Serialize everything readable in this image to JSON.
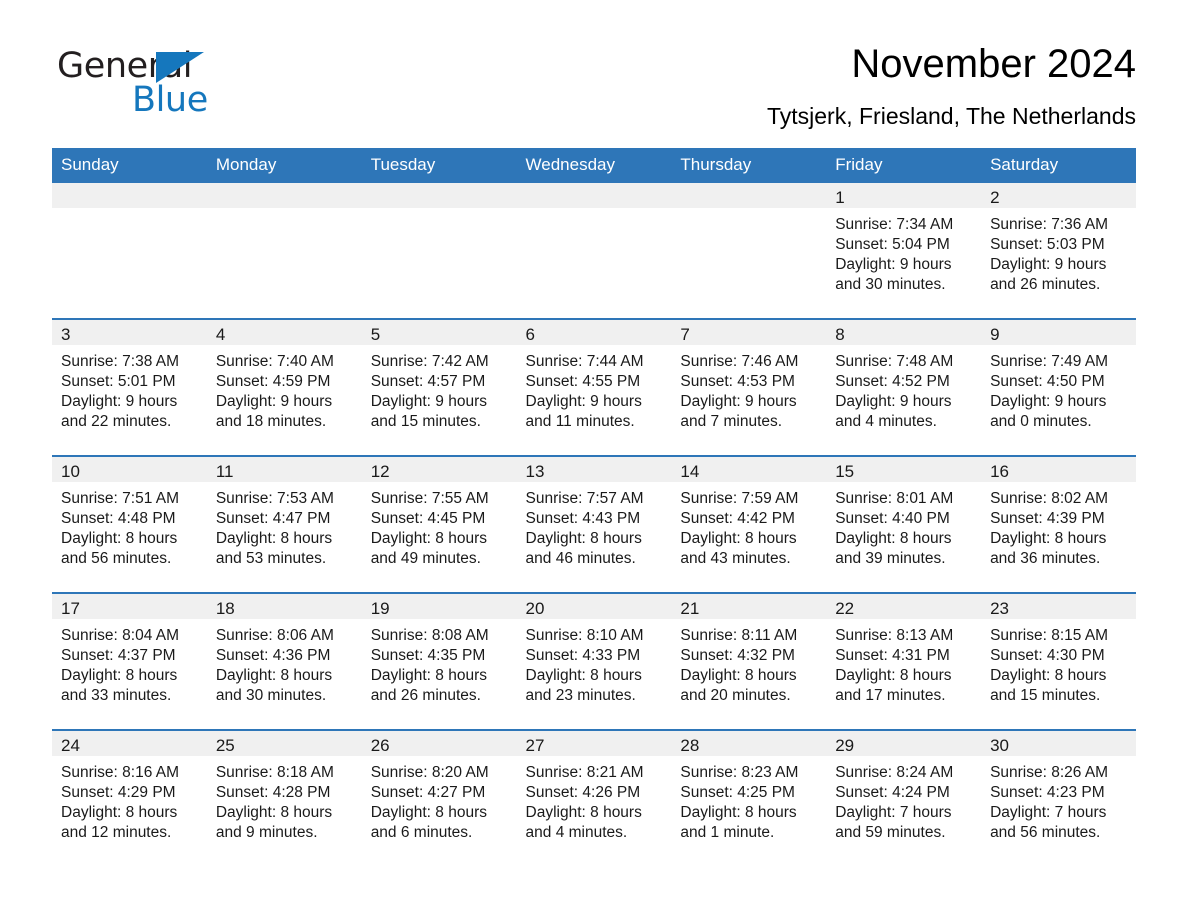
{
  "brand": {
    "name_dark": "General",
    "name_blue": "Blue",
    "triangle_icon": "blue-triangle-logo-mark",
    "accent_color": "#1577bd"
  },
  "header": {
    "month_title": "November 2024",
    "location": "Tytsjerk, Friesland, The Netherlands"
  },
  "theme": {
    "header_band": "#2e76b8",
    "date_band": "#f0f0f0",
    "rule": "#2e76b8",
    "text": "#1a1a1a",
    "page_background": "#ffffff"
  },
  "weekday_headers": [
    "Sunday",
    "Monday",
    "Tuesday",
    "Wednesday",
    "Thursday",
    "Friday",
    "Saturday"
  ],
  "labels": {
    "sunrise_prefix": "Sunrise:",
    "sunset_prefix": "Sunset:",
    "daylight_prefix": "Daylight:"
  },
  "weeks": [
    [
      {
        "date": "",
        "empty": true
      },
      {
        "date": "",
        "empty": true
      },
      {
        "date": "",
        "empty": true
      },
      {
        "date": "",
        "empty": true
      },
      {
        "date": "",
        "empty": true
      },
      {
        "date": "1",
        "sunrise": "Sunrise: 7:34 AM",
        "sunset": "Sunset: 5:04 PM",
        "daylight_line1": "Daylight: 9 hours",
        "daylight_line2": "and 30 minutes."
      },
      {
        "date": "2",
        "sunrise": "Sunrise: 7:36 AM",
        "sunset": "Sunset: 5:03 PM",
        "daylight_line1": "Daylight: 9 hours",
        "daylight_line2": "and 26 minutes."
      }
    ],
    [
      {
        "date": "3",
        "sunrise": "Sunrise: 7:38 AM",
        "sunset": "Sunset: 5:01 PM",
        "daylight_line1": "Daylight: 9 hours",
        "daylight_line2": "and 22 minutes."
      },
      {
        "date": "4",
        "sunrise": "Sunrise: 7:40 AM",
        "sunset": "Sunset: 4:59 PM",
        "daylight_line1": "Daylight: 9 hours",
        "daylight_line2": "and 18 minutes."
      },
      {
        "date": "5",
        "sunrise": "Sunrise: 7:42 AM",
        "sunset": "Sunset: 4:57 PM",
        "daylight_line1": "Daylight: 9 hours",
        "daylight_line2": "and 15 minutes."
      },
      {
        "date": "6",
        "sunrise": "Sunrise: 7:44 AM",
        "sunset": "Sunset: 4:55 PM",
        "daylight_line1": "Daylight: 9 hours",
        "daylight_line2": "and 11 minutes."
      },
      {
        "date": "7",
        "sunrise": "Sunrise: 7:46 AM",
        "sunset": "Sunset: 4:53 PM",
        "daylight_line1": "Daylight: 9 hours",
        "daylight_line2": "and 7 minutes."
      },
      {
        "date": "8",
        "sunrise": "Sunrise: 7:48 AM",
        "sunset": "Sunset: 4:52 PM",
        "daylight_line1": "Daylight: 9 hours",
        "daylight_line2": "and 4 minutes."
      },
      {
        "date": "9",
        "sunrise": "Sunrise: 7:49 AM",
        "sunset": "Sunset: 4:50 PM",
        "daylight_line1": "Daylight: 9 hours",
        "daylight_line2": "and 0 minutes."
      }
    ],
    [
      {
        "date": "10",
        "sunrise": "Sunrise: 7:51 AM",
        "sunset": "Sunset: 4:48 PM",
        "daylight_line1": "Daylight: 8 hours",
        "daylight_line2": "and 56 minutes."
      },
      {
        "date": "11",
        "sunrise": "Sunrise: 7:53 AM",
        "sunset": "Sunset: 4:47 PM",
        "daylight_line1": "Daylight: 8 hours",
        "daylight_line2": "and 53 minutes."
      },
      {
        "date": "12",
        "sunrise": "Sunrise: 7:55 AM",
        "sunset": "Sunset: 4:45 PM",
        "daylight_line1": "Daylight: 8 hours",
        "daylight_line2": "and 49 minutes."
      },
      {
        "date": "13",
        "sunrise": "Sunrise: 7:57 AM",
        "sunset": "Sunset: 4:43 PM",
        "daylight_line1": "Daylight: 8 hours",
        "daylight_line2": "and 46 minutes."
      },
      {
        "date": "14",
        "sunrise": "Sunrise: 7:59 AM",
        "sunset": "Sunset: 4:42 PM",
        "daylight_line1": "Daylight: 8 hours",
        "daylight_line2": "and 43 minutes."
      },
      {
        "date": "15",
        "sunrise": "Sunrise: 8:01 AM",
        "sunset": "Sunset: 4:40 PM",
        "daylight_line1": "Daylight: 8 hours",
        "daylight_line2": "and 39 minutes."
      },
      {
        "date": "16",
        "sunrise": "Sunrise: 8:02 AM",
        "sunset": "Sunset: 4:39 PM",
        "daylight_line1": "Daylight: 8 hours",
        "daylight_line2": "and 36 minutes."
      }
    ],
    [
      {
        "date": "17",
        "sunrise": "Sunrise: 8:04 AM",
        "sunset": "Sunset: 4:37 PM",
        "daylight_line1": "Daylight: 8 hours",
        "daylight_line2": "and 33 minutes."
      },
      {
        "date": "18",
        "sunrise": "Sunrise: 8:06 AM",
        "sunset": "Sunset: 4:36 PM",
        "daylight_line1": "Daylight: 8 hours",
        "daylight_line2": "and 30 minutes."
      },
      {
        "date": "19",
        "sunrise": "Sunrise: 8:08 AM",
        "sunset": "Sunset: 4:35 PM",
        "daylight_line1": "Daylight: 8 hours",
        "daylight_line2": "and 26 minutes."
      },
      {
        "date": "20",
        "sunrise": "Sunrise: 8:10 AM",
        "sunset": "Sunset: 4:33 PM",
        "daylight_line1": "Daylight: 8 hours",
        "daylight_line2": "and 23 minutes."
      },
      {
        "date": "21",
        "sunrise": "Sunrise: 8:11 AM",
        "sunset": "Sunset: 4:32 PM",
        "daylight_line1": "Daylight: 8 hours",
        "daylight_line2": "and 20 minutes."
      },
      {
        "date": "22",
        "sunrise": "Sunrise: 8:13 AM",
        "sunset": "Sunset: 4:31 PM",
        "daylight_line1": "Daylight: 8 hours",
        "daylight_line2": "and 17 minutes."
      },
      {
        "date": "23",
        "sunrise": "Sunrise: 8:15 AM",
        "sunset": "Sunset: 4:30 PM",
        "daylight_line1": "Daylight: 8 hours",
        "daylight_line2": "and 15 minutes."
      }
    ],
    [
      {
        "date": "24",
        "sunrise": "Sunrise: 8:16 AM",
        "sunset": "Sunset: 4:29 PM",
        "daylight_line1": "Daylight: 8 hours",
        "daylight_line2": "and 12 minutes."
      },
      {
        "date": "25",
        "sunrise": "Sunrise: 8:18 AM",
        "sunset": "Sunset: 4:28 PM",
        "daylight_line1": "Daylight: 8 hours",
        "daylight_line2": "and 9 minutes."
      },
      {
        "date": "26",
        "sunrise": "Sunrise: 8:20 AM",
        "sunset": "Sunset: 4:27 PM",
        "daylight_line1": "Daylight: 8 hours",
        "daylight_line2": "and 6 minutes."
      },
      {
        "date": "27",
        "sunrise": "Sunrise: 8:21 AM",
        "sunset": "Sunset: 4:26 PM",
        "daylight_line1": "Daylight: 8 hours",
        "daylight_line2": "and 4 minutes."
      },
      {
        "date": "28",
        "sunrise": "Sunrise: 8:23 AM",
        "sunset": "Sunset: 4:25 PM",
        "daylight_line1": "Daylight: 8 hours",
        "daylight_line2": "and 1 minute."
      },
      {
        "date": "29",
        "sunrise": "Sunrise: 8:24 AM",
        "sunset": "Sunset: 4:24 PM",
        "daylight_line1": "Daylight: 7 hours",
        "daylight_line2": "and 59 minutes."
      },
      {
        "date": "30",
        "sunrise": "Sunrise: 8:26 AM",
        "sunset": "Sunset: 4:23 PM",
        "daylight_line1": "Daylight: 7 hours",
        "daylight_line2": "and 56 minutes."
      }
    ]
  ]
}
